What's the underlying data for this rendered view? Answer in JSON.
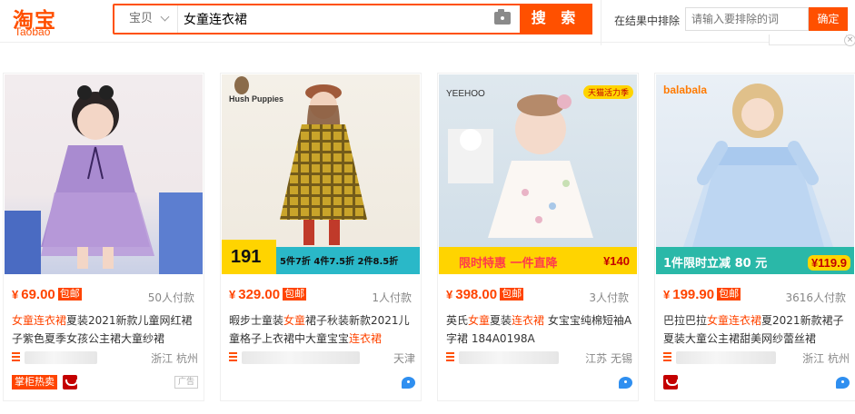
{
  "header": {
    "logo_cn": "淘宝",
    "logo_en": "Taobao",
    "search_scope": "宝贝",
    "search_value": "女童连衣裙",
    "search_button": "搜 索",
    "exclude_label": "在结果中排除",
    "exclude_placeholder": "请输入要排除的词",
    "confirm_button": "确定"
  },
  "colors": {
    "accent": "#ff5000",
    "price": "#ff4400"
  },
  "products": [
    {
      "price": "69.00",
      "paid": "50人付款",
      "title_hl": "女童连衣裙",
      "title_rest": "夏装2021新款儿童网红裙子紫色夏季女孩公主裙大童纱裙",
      "location": "浙江 杭州",
      "tag": "掌柜热卖",
      "ad": "广告",
      "baoyou": "包邮"
    },
    {
      "price": "329.00",
      "paid": "1人付款",
      "title_a": "暇步士童装",
      "title_hl1": "女童",
      "title_b": "裙子秋装新款2021儿童格子上衣裙中大童宝宝",
      "title_hl2": "连衣裙",
      "location": "天津",
      "brand": "Hush Puppies",
      "banner_price": "191",
      "banner_text": "5件7折 4件7.5折 2件8.5折",
      "baoyou": "包邮"
    },
    {
      "price": "398.00",
      "paid": "3人付款",
      "title_a": "英氏",
      "title_hl1": "女童",
      "title_b": "夏装",
      "title_hl2": "连衣裙",
      "title_c": " 女宝宝纯棉短袖A字裙 184A0198A",
      "location": "江苏 无锡",
      "brand": "YEEHOO",
      "badge": "天猫活力季",
      "banner_text": "限时特惠  一件直降",
      "banner_price": "140",
      "baoyou": "包邮"
    },
    {
      "price": "199.90",
      "paid": "3616人付款",
      "title_a": "巴拉巴拉",
      "title_hl": "女童连衣裙",
      "title_b": "夏2021新款裙子夏装大童公主裙甜美网纱蕾丝裙",
      "location": "浙江 杭州",
      "brand": "balabala",
      "banner_text": "1件限时立减  80 元",
      "banner_price": "119.9",
      "baoyou": "包邮"
    }
  ]
}
